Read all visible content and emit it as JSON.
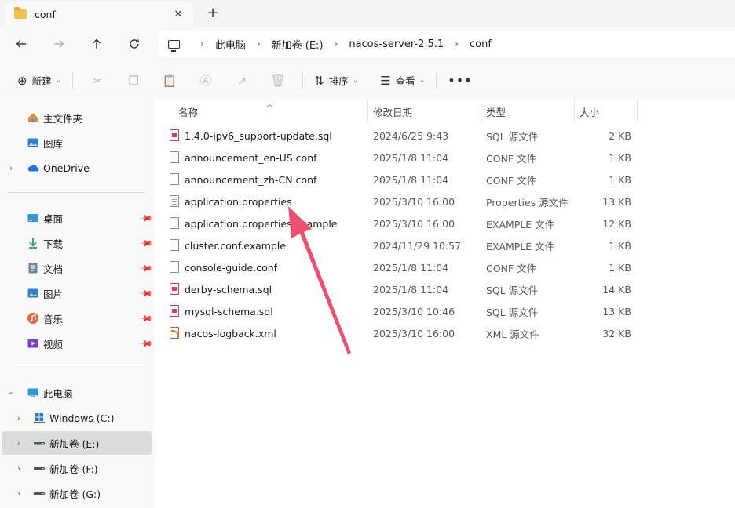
{
  "tab": {
    "title": "conf"
  },
  "breadcrumb": [
    "此电脑",
    "新加卷 (E:)",
    "nacos-server-2.5.1",
    "conf"
  ],
  "toolbar": {
    "new_label": "新建",
    "sort_label": "排序",
    "view_label": "查看"
  },
  "sidebar": {
    "quick": [
      {
        "label": "主文件夹",
        "icon": "home-icon"
      },
      {
        "label": "图库",
        "icon": "gallery-icon"
      },
      {
        "label": "OneDrive",
        "icon": "onedrive-icon"
      }
    ],
    "pinned": [
      {
        "label": "桌面",
        "icon": "desktop-icon"
      },
      {
        "label": "下载",
        "icon": "download-icon"
      },
      {
        "label": "文档",
        "icon": "documents-icon"
      },
      {
        "label": "图片",
        "icon": "pictures-icon"
      },
      {
        "label": "音乐",
        "icon": "music-icon"
      },
      {
        "label": "视频",
        "icon": "videos-icon"
      }
    ],
    "this_pc": {
      "label": "此电脑"
    },
    "drives": [
      {
        "label": "Windows (C:)",
        "icon": "windows-drive-icon"
      },
      {
        "label": "新加卷 (E:)",
        "icon": "drive-icon",
        "selected": true
      },
      {
        "label": "新加卷 (F:)",
        "icon": "drive-icon"
      },
      {
        "label": "新加卷 (G:)",
        "icon": "drive-icon"
      }
    ]
  },
  "columns": {
    "name": "名称",
    "date": "修改日期",
    "type": "类型",
    "size": "大小"
  },
  "files": [
    {
      "name": "1.4.0-ipv6_support-update.sql",
      "date": "2024/6/25 9:43",
      "type": "SQL 源文件",
      "size": "2 KB",
      "icon": "sql-file-icon"
    },
    {
      "name": "announcement_en-US.conf",
      "date": "2025/1/8 11:04",
      "type": "CONF 文件",
      "size": "1 KB",
      "icon": "file-icon"
    },
    {
      "name": "announcement_zh-CN.conf",
      "date": "2025/1/8 11:04",
      "type": "CONF 文件",
      "size": "1 KB",
      "icon": "file-icon"
    },
    {
      "name": "application.properties",
      "date": "2025/3/10 16:00",
      "type": "Properties 源文件",
      "size": "13 KB",
      "icon": "properties-file-icon"
    },
    {
      "name": "application.properties.example",
      "date": "2025/3/10 16:00",
      "type": "EXAMPLE 文件",
      "size": "12 KB",
      "icon": "file-icon"
    },
    {
      "name": "cluster.conf.example",
      "date": "2024/11/29 10:57",
      "type": "EXAMPLE 文件",
      "size": "1 KB",
      "icon": "file-icon"
    },
    {
      "name": "console-guide.conf",
      "date": "2025/1/8 11:04",
      "type": "CONF 文件",
      "size": "1 KB",
      "icon": "file-icon"
    },
    {
      "name": "derby-schema.sql",
      "date": "2025/1/8 11:04",
      "type": "SQL 源文件",
      "size": "14 KB",
      "icon": "sql-file-icon"
    },
    {
      "name": "mysql-schema.sql",
      "date": "2025/3/10 10:46",
      "type": "SQL 源文件",
      "size": "13 KB",
      "icon": "sql-file-icon"
    },
    {
      "name": "nacos-logback.xml",
      "date": "2025/3/10 16:00",
      "type": "XML 源文件",
      "size": "32 KB",
      "icon": "xml-file-icon"
    }
  ],
  "colors": {
    "annotation_arrow": "#f0506e",
    "selected_bg": "#dcdcdc",
    "accent_blue": "#1a73e8"
  }
}
